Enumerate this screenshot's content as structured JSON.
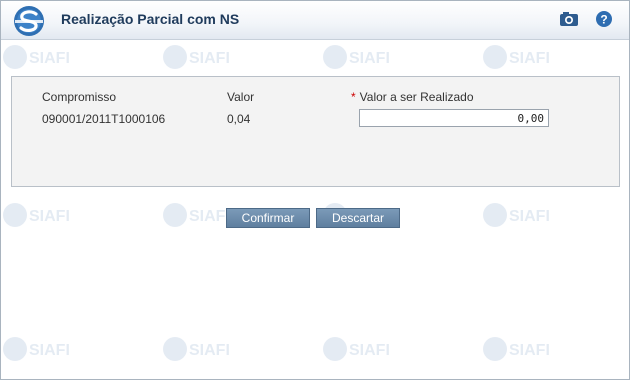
{
  "window": {
    "title": "Realização Parcial com NS",
    "camera_icon": "camera-icon",
    "help_icon": "help-icon",
    "help_glyph": "?"
  },
  "watermark": {
    "text": "SIAFI"
  },
  "form": {
    "headers": {
      "compromisso": "Compromisso",
      "valor": "Valor",
      "valor_realizado": "Valor a ser Realizado",
      "required_marker": "*"
    },
    "row": {
      "compromisso": "090001/2011T1000106",
      "valor": "0,04",
      "valor_realizado": "0,00"
    }
  },
  "actions": {
    "confirm_label": "Confirmar",
    "discard_label": "Descartar"
  },
  "colors": {
    "title_text": "#1f3b5c",
    "button_bg": "#6a89a8",
    "required": "#cc0000",
    "logo_blue": "#2f6fb2"
  }
}
